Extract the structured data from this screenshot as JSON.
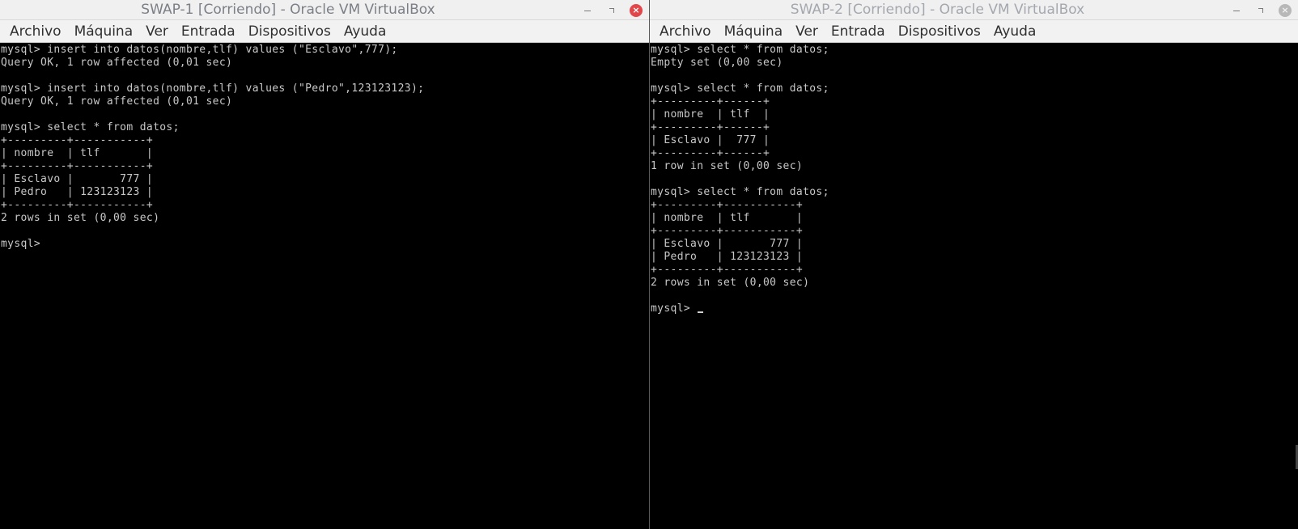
{
  "vm1": {
    "title": "SWAP-1 [Corriendo] - Oracle VM VirtualBox",
    "menu": [
      "Archivo",
      "Máquina",
      "Ver",
      "Entrada",
      "Dispositivos",
      "Ayuda"
    ],
    "console_text": "mysql> insert into datos(nombre,tlf) values (\"Esclavo\",777);\nQuery OK, 1 row affected (0,01 sec)\n\nmysql> insert into datos(nombre,tlf) values (\"Pedro\",123123123);\nQuery OK, 1 row affected (0,01 sec)\n\nmysql> select * from datos;\n+---------+-----------+\n| nombre  | tlf       |\n+---------+-----------+\n| Esclavo |       777 |\n| Pedro   | 123123123 |\n+---------+-----------+\n2 rows in set (0,00 sec)\n\nmysql>"
  },
  "vm2": {
    "title": "SWAP-2 [Corriendo] - Oracle VM VirtualBox",
    "menu": [
      "Archivo",
      "Máquina",
      "Ver",
      "Entrada",
      "Dispositivos",
      "Ayuda"
    ],
    "console_text": "mysql> select * from datos;\nEmpty set (0,00 sec)\n\nmysql> select * from datos;\n+---------+------+\n| nombre  | tlf  |\n+---------+------+\n| Esclavo |  777 |\n+---------+------+\n1 row in set (0,00 sec)\n\nmysql> select * from datos;\n+---------+-----------+\n| nombre  | tlf       |\n+---------+-----------+\n| Esclavo |       777 |\n| Pedro   | 123123123 |\n+---------+-----------+\n2 rows in set (0,00 sec)\n\nmysql> "
  },
  "controls": {
    "minimize_icon": "minimize-icon",
    "maximize_icon": "maximize-icon",
    "close_icon": "close-icon",
    "close_glyph": "×"
  },
  "colors": {
    "active_close": "#e2464b",
    "inactive_close": "#b8b8b8",
    "terminal_bg": "#000000",
    "terminal_text": "#c8c8c8"
  }
}
